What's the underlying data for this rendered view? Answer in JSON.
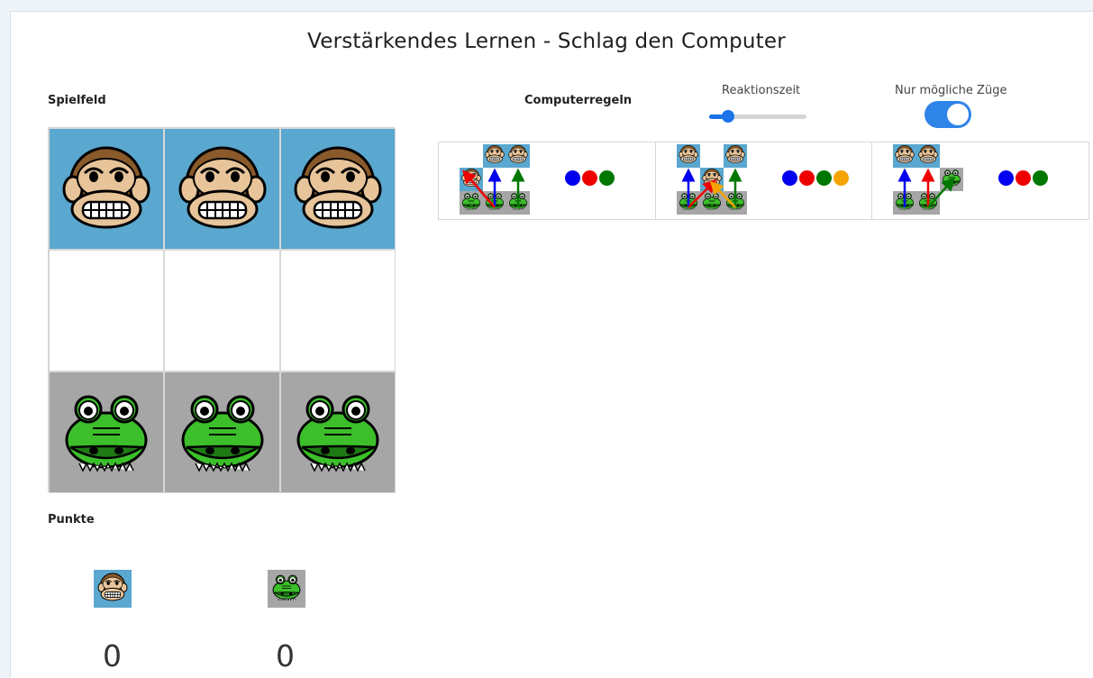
{
  "title": "Verstärkendes Lernen - Schlag den Computer",
  "board_label": "Spielfeld",
  "rules_label": "Computerregeln",
  "reaction_time_label": "Reaktionszeit",
  "only_possible_moves_label": "Nur mögliche Züge",
  "reaction_time_level": 0.15,
  "only_possible_moves_on": true,
  "points_label": "Punkte",
  "board": [
    [
      "monkey",
      "monkey",
      "monkey"
    ],
    [
      "empty",
      "empty",
      "empty"
    ],
    [
      "croc",
      "croc",
      "croc"
    ]
  ],
  "scores": {
    "monkey": "0",
    "croc": "0"
  },
  "rules": [
    {
      "board": [
        [
          "empty",
          "monkey",
          "monkey"
        ],
        [
          "monkey",
          "empty",
          "empty"
        ],
        [
          "croc",
          "croc",
          "croc"
        ]
      ],
      "moves": [
        "blue",
        "red",
        "green"
      ]
    },
    {
      "board": [
        [
          "monkey",
          "empty",
          "monkey"
        ],
        [
          "empty",
          "monkey",
          "empty"
        ],
        [
          "croc",
          "croc",
          "croc"
        ]
      ],
      "moves": [
        "blue",
        "red",
        "green",
        "orange"
      ]
    },
    {
      "board": [
        [
          "monkey",
          "monkey",
          "empty"
        ],
        [
          "empty",
          "empty",
          "croc"
        ],
        [
          "croc",
          "croc",
          "empty"
        ]
      ],
      "moves": [
        "blue",
        "red",
        "green"
      ]
    }
  ],
  "colors": {
    "blue": "#0000ee",
    "red": "#ee0000",
    "green": "#007700",
    "orange": "#f5a300",
    "board_blue": "#5aa7cf",
    "board_gray": "#a6a6a6"
  }
}
